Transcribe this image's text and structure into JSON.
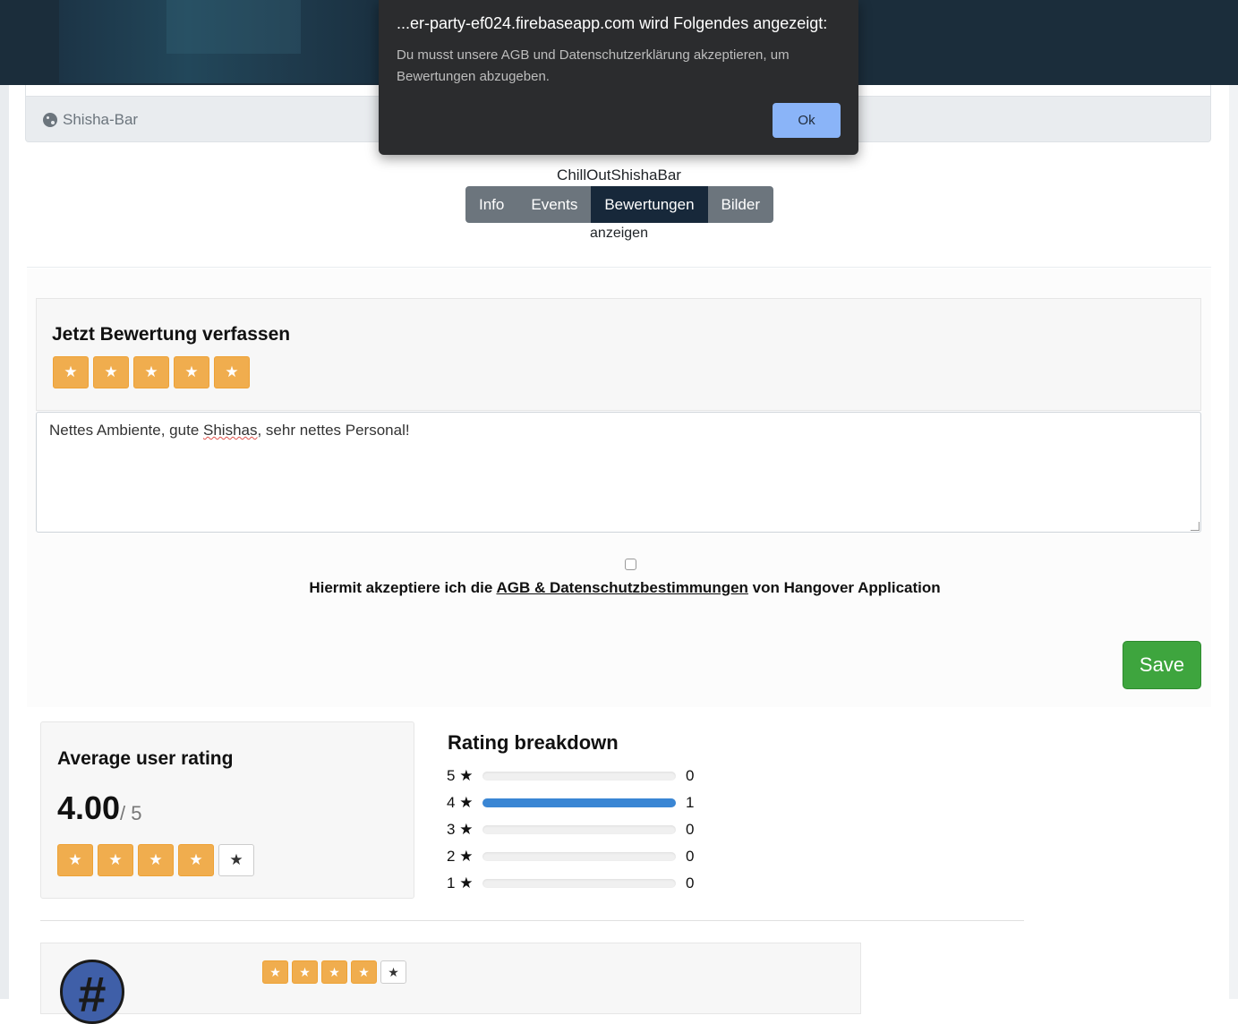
{
  "header": {
    "category_label": "Shisha-Bar",
    "category_icon": "palette-icon"
  },
  "dialog": {
    "title": "...er-party-ef024.firebaseapp.com wird Folgendes angezeigt:",
    "message": "Du musst unsere AGB und Datenschutzerklärung akzeptieren, um Bewertungen abzugeben.",
    "ok_label": "Ok",
    "ok_color": "#8ab4f8"
  },
  "place": {
    "name": "ChillOutShishaBar",
    "show_label": "anzeigen"
  },
  "tabs": [
    {
      "label": "Info",
      "active": false
    },
    {
      "label": "Events",
      "active": false
    },
    {
      "label": "Bewertungen",
      "active": true
    },
    {
      "label": "Bilder",
      "active": false
    }
  ],
  "write_review": {
    "title": "Jetzt Bewertung verfassen",
    "selected_stars": 5,
    "max_stars": 5,
    "text_before": "Nettes Ambiente, gute ",
    "text_misspelled": "Shishas",
    "text_after": ", sehr nettes Personal!",
    "agb_checked": false,
    "agb_prefix": "Hiermit akzeptiere ich die ",
    "agb_link": "AGB & Datenschutzbestimmungen",
    "agb_suffix": " von Hangover Application",
    "save_label": "Save",
    "star_color": "#f0ad4e"
  },
  "average": {
    "title": "Average user rating",
    "value": "4.00",
    "max": "/ 5",
    "stars_filled": 4
  },
  "breakdown": {
    "title": "Rating breakdown",
    "rows": [
      {
        "label": "5",
        "count": "0",
        "fraction": 0
      },
      {
        "label": "4",
        "count": "1",
        "fraction": 1
      },
      {
        "label": "3",
        "count": "0",
        "fraction": 0
      },
      {
        "label": "2",
        "count": "0",
        "fraction": 0
      },
      {
        "label": "1",
        "count": "0",
        "fraction": 0
      }
    ],
    "bar_color": "#3a86d4"
  },
  "user_review": {
    "stars_filled": 4,
    "avatar_glyph": "#"
  }
}
